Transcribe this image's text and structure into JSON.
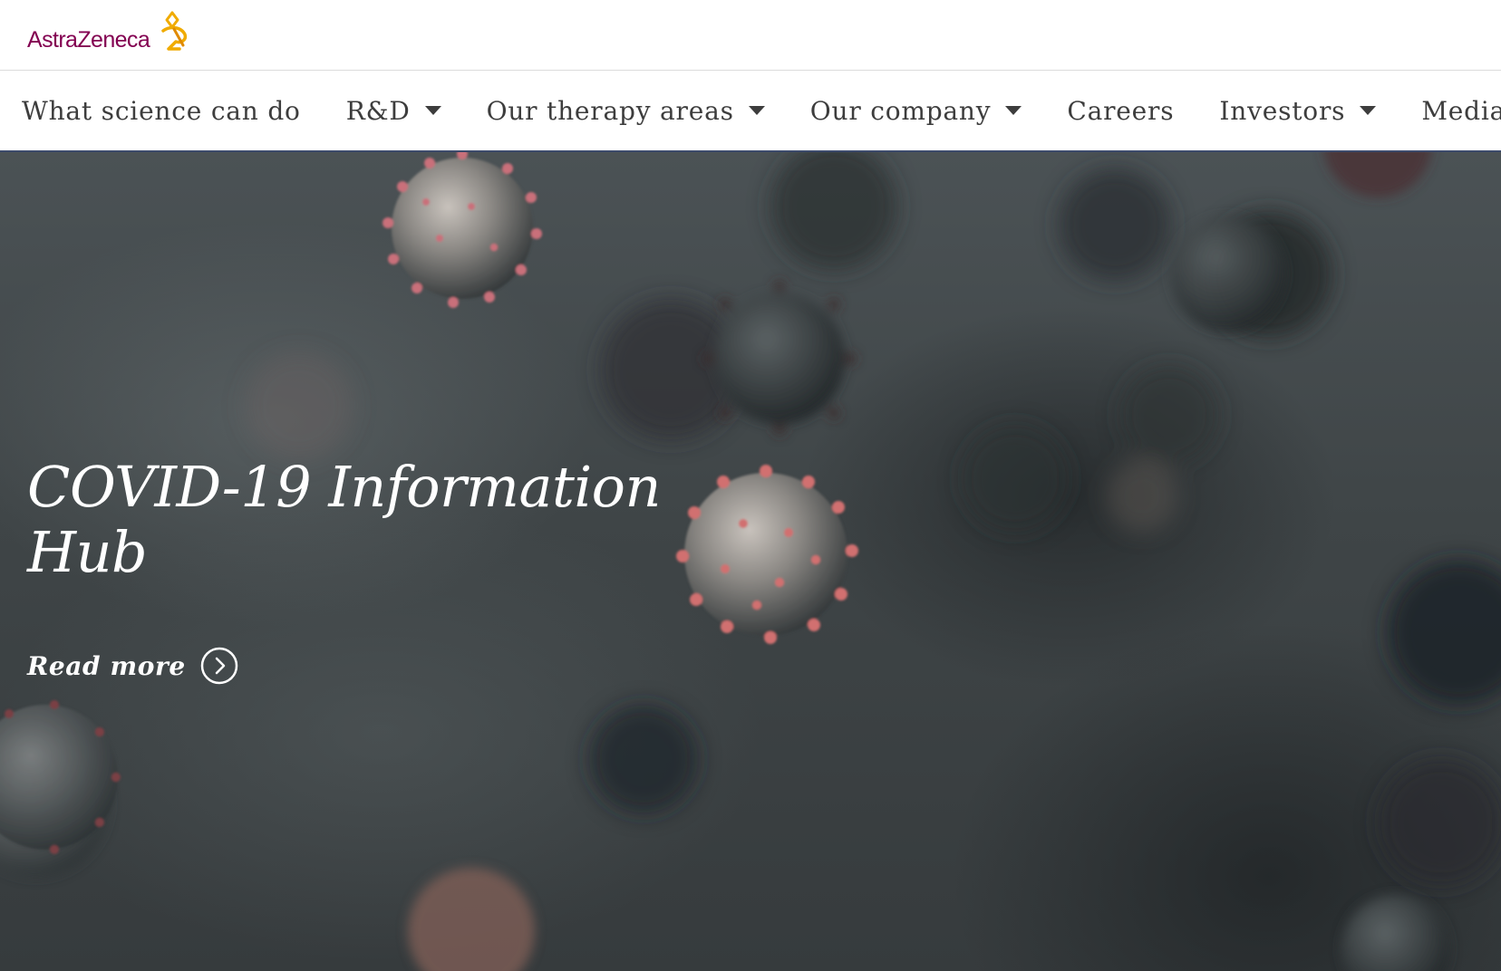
{
  "brand": {
    "name": "AstraZeneca",
    "primary_color": "#830051",
    "accent_color": "#F0AB00"
  },
  "nav": {
    "items": [
      {
        "label": "What science can do",
        "has_dropdown": false
      },
      {
        "label": "R&D",
        "has_dropdown": true
      },
      {
        "label": "Our therapy areas",
        "has_dropdown": true
      },
      {
        "label": "Our company",
        "has_dropdown": true
      },
      {
        "label": "Careers",
        "has_dropdown": false
      },
      {
        "label": "Investors",
        "has_dropdown": true
      },
      {
        "label": "Media",
        "has_dropdown": true
      }
    ]
  },
  "hero": {
    "title": "COVID-19 Information Hub",
    "cta_label": "Read more",
    "cta_icon": "chevron-right-circle-icon",
    "background": "coronavirus-particles-image"
  }
}
